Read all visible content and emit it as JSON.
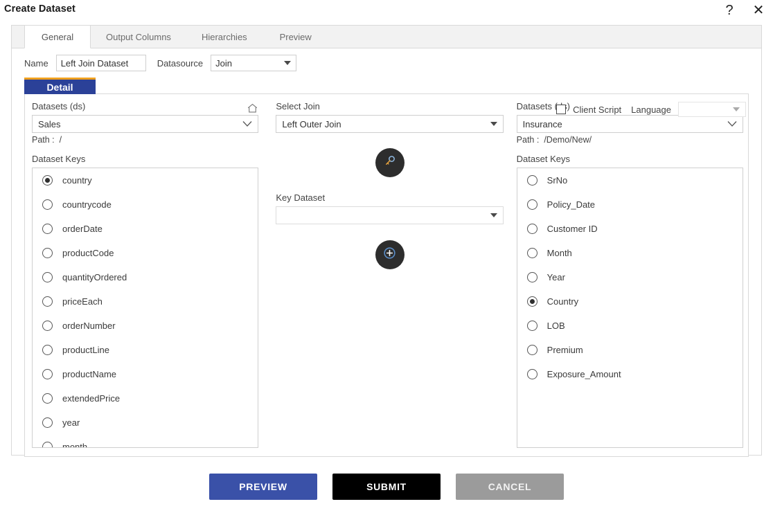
{
  "window": {
    "title": "Create Dataset",
    "help_icon": "question-mark-icon",
    "close_icon": "close-icon"
  },
  "tabs": [
    {
      "label": "General",
      "active": true
    },
    {
      "label": "Output Columns",
      "active": false
    },
    {
      "label": "Hierarchies",
      "active": false
    },
    {
      "label": "Preview",
      "active": false
    }
  ],
  "form": {
    "name_label": "Name",
    "name_value": "Left Join Dataset",
    "name_placeholder": "",
    "datasource_label": "Datasource",
    "datasource_value": "Join"
  },
  "detail_tab": {
    "label": "Detail",
    "accent_color": "#f0a01e",
    "background_color": "#2b4198"
  },
  "client_script": {
    "checkbox_label": "Client Script",
    "checked": false,
    "language_label": "Language",
    "language_value": ""
  },
  "left_panel": {
    "datasets_label": "Datasets (ds)",
    "home_icon": "home-icon",
    "dataset_value": "Sales",
    "path_label": "Path :",
    "path_value": "/",
    "keys_label": "Dataset Keys",
    "keys": [
      {
        "label": "country",
        "selected": true
      },
      {
        "label": "countrycode",
        "selected": false
      },
      {
        "label": "orderDate",
        "selected": false
      },
      {
        "label": "productCode",
        "selected": false
      },
      {
        "label": "quantityOrdered",
        "selected": false
      },
      {
        "label": "priceEach",
        "selected": false
      },
      {
        "label": "orderNumber",
        "selected": false
      },
      {
        "label": "productLine",
        "selected": false
      },
      {
        "label": "productName",
        "selected": false
      },
      {
        "label": "extendedPrice",
        "selected": false
      },
      {
        "label": "year",
        "selected": false
      },
      {
        "label": "month",
        "selected": false
      }
    ]
  },
  "middle_panel": {
    "join_label": "Select Join",
    "join_value": "Left Outer Join",
    "key_icon": "key-icon",
    "key_dataset_label": "Key Dataset",
    "key_dataset_value": "",
    "add_icon": "plus-circle-icon"
  },
  "right_panel": {
    "datasets_label": "Datasets (ds)",
    "home_icon": "home-icon",
    "dataset_value": "Insurance",
    "path_label": "Path :",
    "path_value": "/Demo/New/",
    "keys_label": "Dataset Keys",
    "keys": [
      {
        "label": "SrNo",
        "selected": false
      },
      {
        "label": "Policy_Date",
        "selected": false
      },
      {
        "label": "Customer ID",
        "selected": false
      },
      {
        "label": "Month",
        "selected": false
      },
      {
        "label": "Year",
        "selected": false
      },
      {
        "label": "Country",
        "selected": true
      },
      {
        "label": "LOB",
        "selected": false
      },
      {
        "label": "Premium",
        "selected": false
      },
      {
        "label": "Exposure_Amount",
        "selected": false
      }
    ]
  },
  "footer": {
    "preview_label": "PREVIEW",
    "submit_label": "SUBMIT",
    "cancel_label": "CANCEL",
    "preview_color": "#3a51a8",
    "submit_color": "#000000",
    "cancel_color": "#9b9b9b"
  }
}
